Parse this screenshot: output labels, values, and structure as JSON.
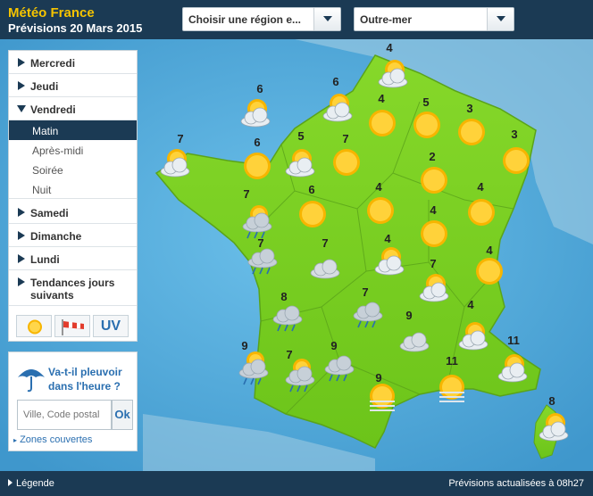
{
  "header": {
    "brand": "Météo France",
    "date": "Prévisions 20 Mars 2015",
    "region_select": "Choisir une région e...",
    "outremer_select": "Outre-mer"
  },
  "sidebar": {
    "days": [
      {
        "label": "Mercredi",
        "expanded": false
      },
      {
        "label": "Jeudi",
        "expanded": false
      },
      {
        "label": "Vendredi",
        "expanded": true
      }
    ],
    "periods": [
      {
        "label": "Matin",
        "active": true
      },
      {
        "label": "Après-midi",
        "active": false
      },
      {
        "label": "Soirée",
        "active": false
      },
      {
        "label": "Nuit",
        "active": false
      }
    ],
    "more_days": [
      {
        "label": "Samedi"
      },
      {
        "label": "Dimanche"
      },
      {
        "label": "Lundi"
      },
      {
        "label": "Tendances jours suivants"
      }
    ],
    "tabs": {
      "uv": "UV"
    }
  },
  "rainbox": {
    "question": "Va-t-il pleuvoir dans l'heure ?",
    "placeholder": "Ville, Code postal",
    "ok": "Ok",
    "zones": "Zones couvertes"
  },
  "footer": {
    "legend": "Légende",
    "update": "Prévisions actualisées à 08h27"
  },
  "colors": {
    "land": "#7ed321",
    "sea": "#4aa6d8",
    "header": "#1b3a54",
    "brand": "#f5c400",
    "link": "#2a6fb0"
  },
  "forecasts": [
    {
      "temp": "4",
      "icon": "sun-cloud"
    },
    {
      "temp": "6",
      "icon": "sun-cloud"
    },
    {
      "temp": "6",
      "icon": "sun-cloud"
    },
    {
      "temp": "4",
      "icon": "sun"
    },
    {
      "temp": "5",
      "icon": "sun"
    },
    {
      "temp": "3",
      "icon": "sun"
    },
    {
      "temp": "7",
      "icon": "sun-cloud"
    },
    {
      "temp": "6",
      "icon": "sun"
    },
    {
      "temp": "5",
      "icon": "sun-cloud"
    },
    {
      "temp": "7",
      "icon": "sun"
    },
    {
      "temp": "3",
      "icon": "sun"
    },
    {
      "temp": "2",
      "icon": "sun"
    },
    {
      "temp": "7",
      "icon": "sun-cloud-rain"
    },
    {
      "temp": "6",
      "icon": "sun"
    },
    {
      "temp": "4",
      "icon": "sun"
    },
    {
      "temp": "4",
      "icon": "sun"
    },
    {
      "temp": "4",
      "icon": "sun"
    },
    {
      "temp": "7",
      "icon": "cloud"
    },
    {
      "temp": "7",
      "icon": "cloud-rain"
    },
    {
      "temp": "4",
      "icon": "sun-cloud"
    },
    {
      "temp": "7",
      "icon": "sun-cloud"
    },
    {
      "temp": "4",
      "icon": "sun"
    },
    {
      "temp": "8",
      "icon": "cloud-rain"
    },
    {
      "temp": "7",
      "icon": "cloud-rain"
    },
    {
      "temp": "9",
      "icon": "cloud"
    },
    {
      "temp": "4",
      "icon": "sun-cloud"
    },
    {
      "temp": "9",
      "icon": "sun-cloud-rain"
    },
    {
      "temp": "7",
      "icon": "sun-cloud-rain"
    },
    {
      "temp": "9",
      "icon": "cloud-rain"
    },
    {
      "temp": "9",
      "icon": "sun-fog"
    },
    {
      "temp": "11",
      "icon": "sun-fog"
    },
    {
      "temp": "11",
      "icon": "sun-cloud"
    },
    {
      "temp": "8",
      "icon": "sun-cloud"
    }
  ]
}
